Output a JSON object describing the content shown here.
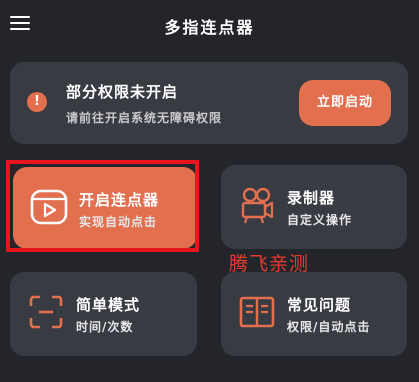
{
  "header": {
    "title": "多指连点器",
    "menu_icon": "hamburger-menu-icon"
  },
  "permission_card": {
    "title": "部分权限未开启",
    "subtitle": "请前往开启系统无障碍权限",
    "button_label": "立即启动",
    "icon": "warning-icon"
  },
  "tiles": {
    "start": {
      "title": "开启连点器",
      "subtitle": "实现自动点击",
      "icon": "play-video-icon"
    },
    "record": {
      "title": "录制器",
      "subtitle": "自定义操作",
      "icon": "film-camera-icon"
    },
    "simple": {
      "title": "简单模式",
      "subtitle": "时间/次数",
      "icon": "focus-frame-icon"
    },
    "faq": {
      "title": "常见问题",
      "subtitle": "权限/自动点击",
      "icon": "open-book-icon"
    }
  },
  "watermark": "腾飞亲测",
  "colors": {
    "background": "#24252b",
    "card": "#393b43",
    "accent": "#e2704f",
    "highlight": "#e8141e",
    "watermark": "#e63c2d"
  }
}
